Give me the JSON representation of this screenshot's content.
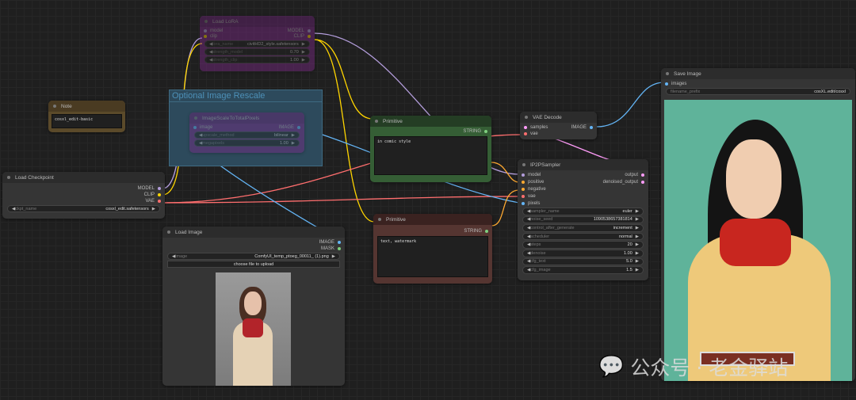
{
  "note": {
    "title": "Note",
    "text": "cosxl_edit-basic"
  },
  "lora": {
    "title": "Load LoRA",
    "inputs": [
      "model",
      "clip"
    ],
    "outputs": [
      "MODEL",
      "CLIP"
    ],
    "widgets": [
      {
        "label": "lora_name",
        "value": "civitHD2_style.safetensors"
      },
      {
        "label": "strength_model",
        "value": "0.70"
      },
      {
        "label": "strength_clip",
        "value": "1.00"
      }
    ]
  },
  "group": {
    "title": "Optional Image Rescale"
  },
  "scale": {
    "title": "ImageScaleToTotalPixels",
    "input": "image",
    "output": "IMAGE",
    "widgets": [
      {
        "label": "upscale_method",
        "value": "bilinear"
      },
      {
        "label": "megapixels",
        "value": "1.00"
      }
    ]
  },
  "checkpoint": {
    "title": "Load Checkpoint",
    "outputs": [
      "MODEL",
      "CLIP",
      "VAE"
    ],
    "widget": {
      "label": "ckpt_name",
      "value": "cosxl_edit.safetensors"
    }
  },
  "load_image": {
    "title": "Load Image",
    "outputs": [
      "IMAGE",
      "MASK"
    ],
    "widget": {
      "label": "image",
      "value": "ComfyUI_temp_ptoeg_00011_ (1).png"
    },
    "upload": "choose file to upload"
  },
  "prim1": {
    "title": "Primitive",
    "output": "STRING",
    "text": "in comic style"
  },
  "prim2": {
    "title": "Primitive",
    "output": "STRING",
    "text": "text, watermark"
  },
  "vae": {
    "title": "VAE Decode",
    "inputs": [
      "samples",
      "vae"
    ],
    "output": "IMAGE"
  },
  "sampler": {
    "title": "IP2PSampler",
    "inputs": [
      "model",
      "positive",
      "negative",
      "vae",
      "pixels"
    ],
    "outputs": [
      "output",
      "denoised_output"
    ],
    "widgets": [
      {
        "label": "sampler_name",
        "value": "euler"
      },
      {
        "label": "noise_seed",
        "value": "1090538657381814"
      },
      {
        "label": "control_after_generate",
        "value": "increment"
      },
      {
        "label": "scheduler",
        "value": "normal"
      },
      {
        "label": "steps",
        "value": "20"
      },
      {
        "label": "denoise",
        "value": "1.00"
      },
      {
        "label": "cfg_text",
        "value": "5.0"
      },
      {
        "label": "cfg_image",
        "value": "1.5"
      }
    ]
  },
  "save": {
    "title": "Save Image",
    "input": "images",
    "widget": {
      "label": "filename_prefix",
      "value": "cosXL.edit/cosxl"
    }
  },
  "watermark": "公众号 · 老金驿站",
  "colors": {
    "model": "#b39ddb",
    "clip": "#ffd500",
    "vae": "#ff6e6e",
    "image": "#64b5f6",
    "latent": "#ff9cf9",
    "conditioning": "#ffa931",
    "string": "#7ecf7e"
  }
}
